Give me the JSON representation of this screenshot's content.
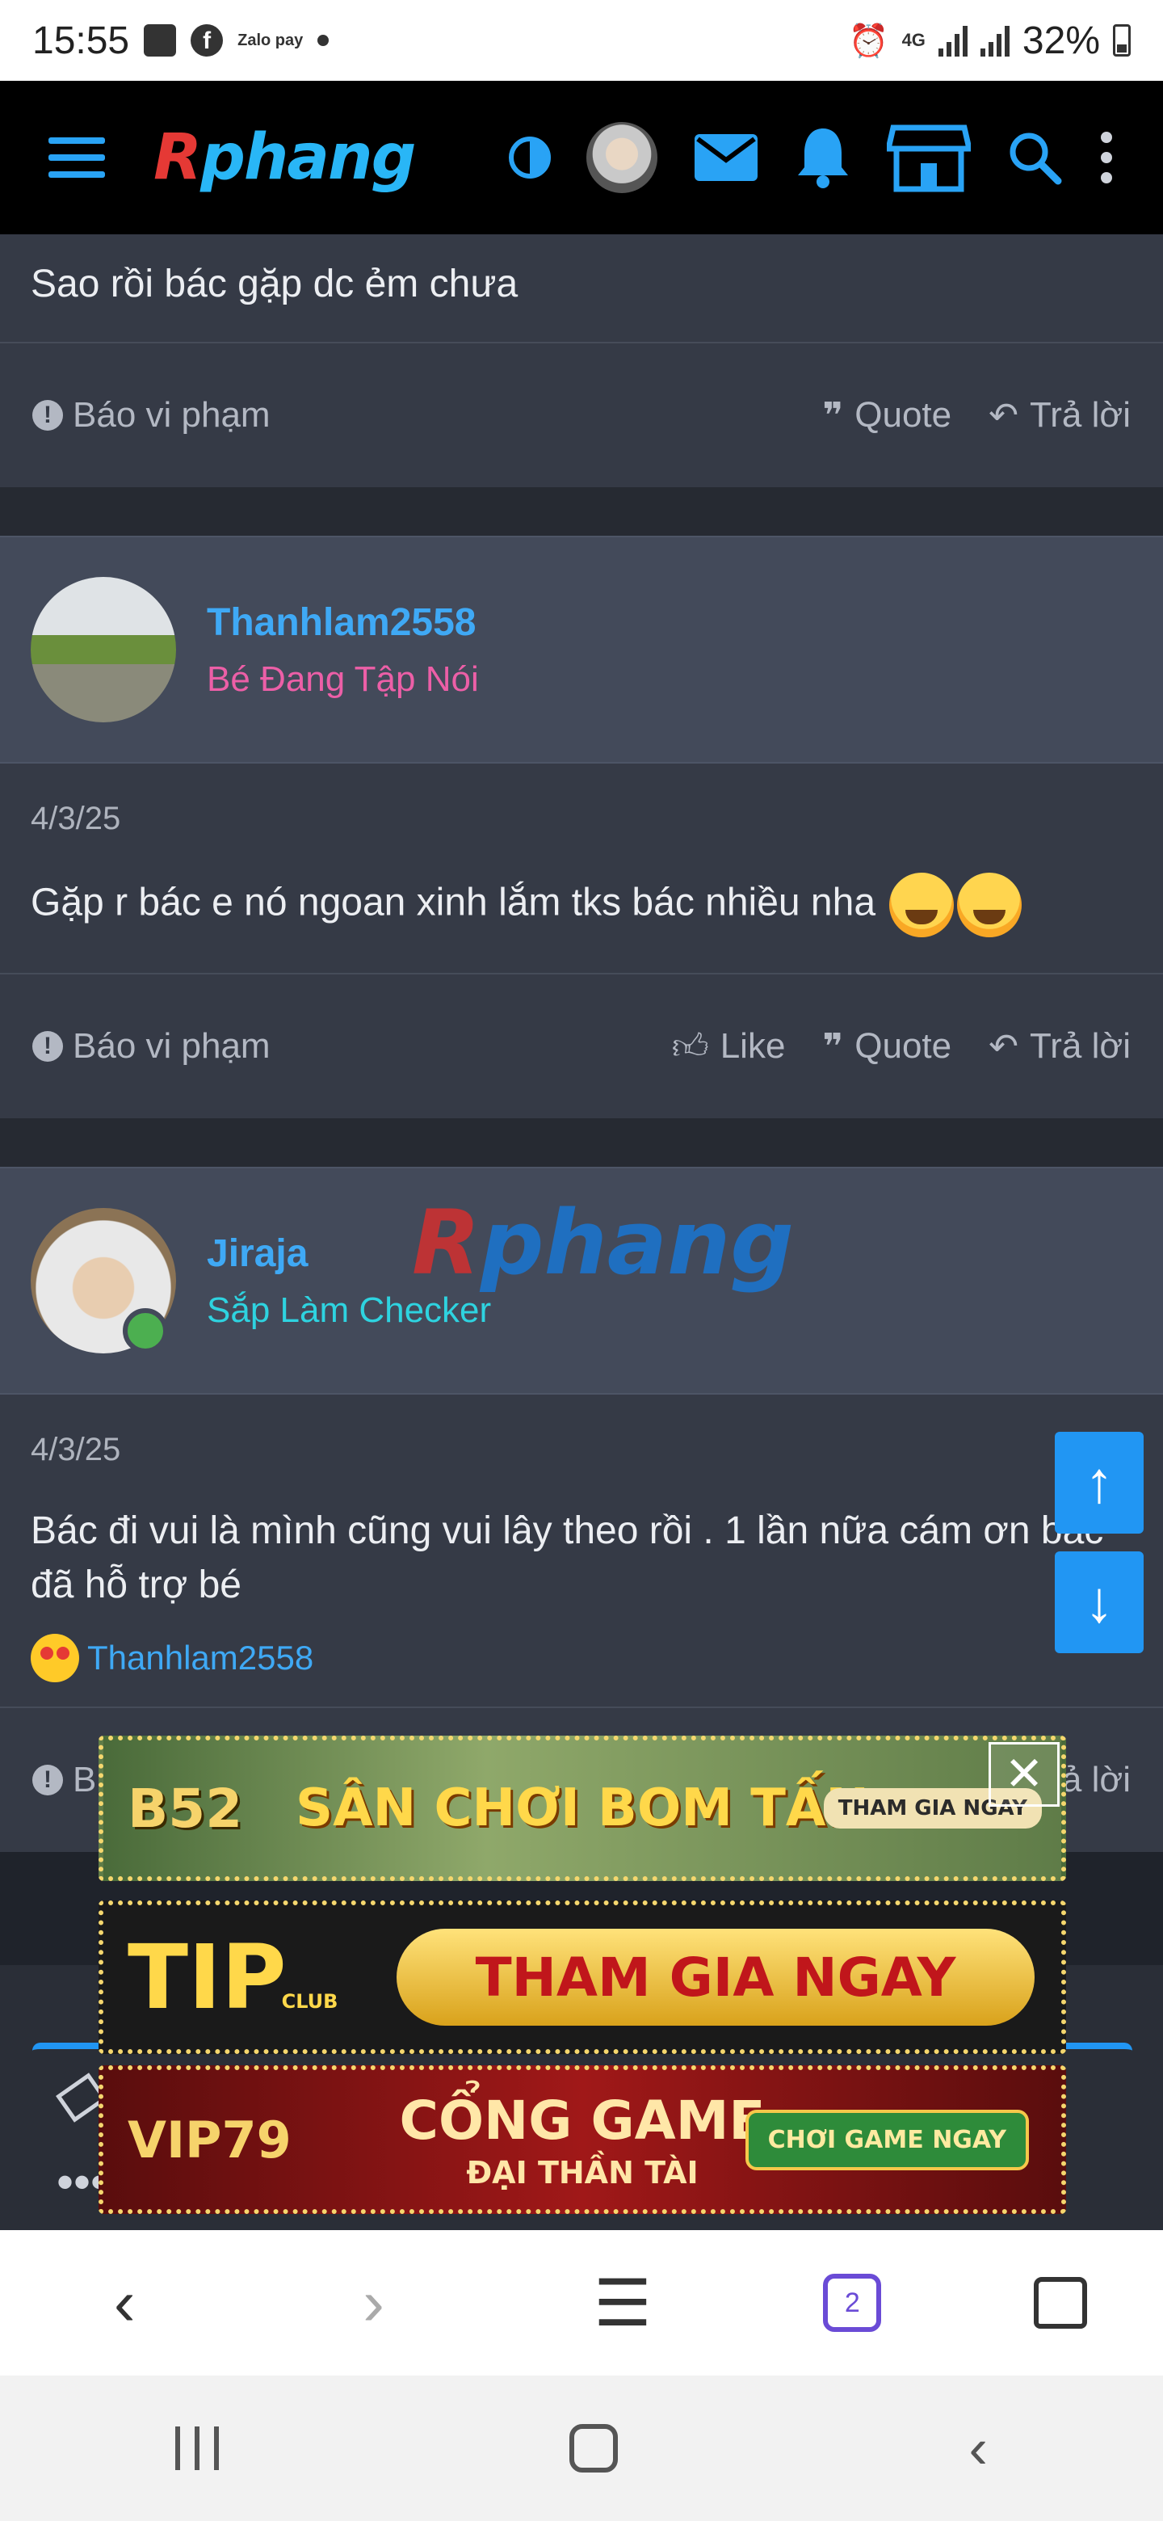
{
  "status_bar": {
    "time": "15:55",
    "zalo": "Zalo pay",
    "net": "4G",
    "battery": "32%"
  },
  "header": {
    "logo_r": "R",
    "logo_rest": "phang"
  },
  "posts": [
    {
      "body": "Sao rồi bác gặp dc ẻm chưa"
    },
    {
      "username": "Thanhlam2558",
      "user_title": "Bé Đang Tập Nói",
      "date": "4/3/25",
      "body": "Gặp r bác e nó ngoan xinh lắm tks bác nhiều nha"
    },
    {
      "username": "Jiraja",
      "user_title": "Sắp Làm Checker",
      "date": "4/3/25",
      "body": "Bác đi vui là mình cũng vui lây theo rồi . 1 lần nữa cám ơn bác đã hỗ trợ bé",
      "reaction_user": "Thanhlam2558"
    }
  ],
  "actions": {
    "report": "Báo vi phạm",
    "like": "Like",
    "quote": "Quote",
    "reply": "Trả lời",
    "report_partial": "B",
    "reply_partial": "ả lời"
  },
  "watermark": {
    "r": "R",
    "rest": "phang"
  },
  "ads": [
    {
      "brand": "B52",
      "text": "SÂN CHƠI BOM TẤN",
      "cta": "THAM GIA NGAY"
    },
    {
      "brand": "TIP",
      "brand_sub": "CLUB",
      "text": "THAM GIA NGAY"
    },
    {
      "brand": "VIP79",
      "line1": "CỔNG GAME",
      "line2": "ĐẠI THẦN TÀI",
      "cta": "CHƠI GAME NGAY"
    }
  ],
  "browser_nav": {
    "tab_count": "2"
  },
  "colors": {
    "accent": "#29a3f5",
    "link": "#3fa9f5",
    "rank_pink": "#ec5fa7",
    "rank_cyan": "#2ed3e0",
    "bg": "#353a46"
  }
}
